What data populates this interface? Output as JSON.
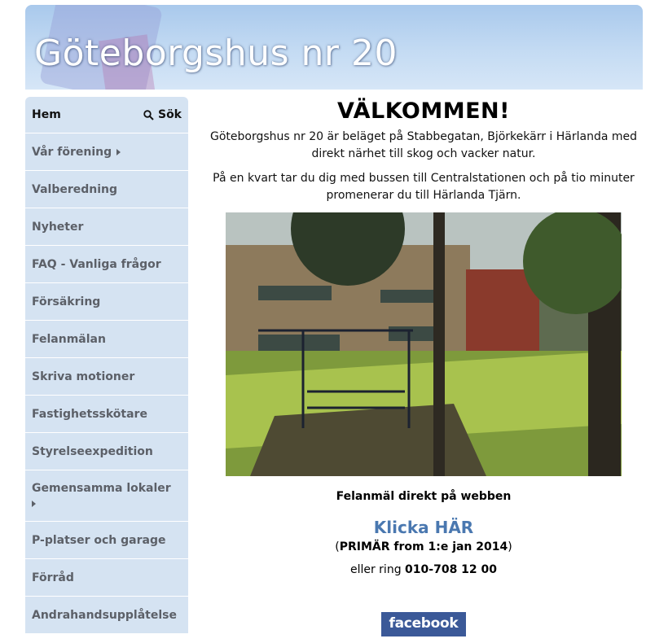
{
  "header": {
    "site_title": "Göteborgshus nr 20"
  },
  "nav": {
    "home_label": "Hem",
    "search_label": "Sök",
    "items": [
      {
        "label": "Vår förening",
        "submenu": true
      },
      {
        "label": "Valberedning",
        "submenu": false
      },
      {
        "label": "Nyheter",
        "submenu": false
      },
      {
        "label": "FAQ - Vanliga frågor",
        "submenu": false
      },
      {
        "label": "Försäkring",
        "submenu": false
      },
      {
        "label": "Felanmälan",
        "submenu": false
      },
      {
        "label": "Skriva motioner",
        "submenu": false
      },
      {
        "label": "Fastighetsskötare",
        "submenu": false
      },
      {
        "label": "Styrelseexpedition",
        "submenu": false
      },
      {
        "label": "Gemensamma lokaler",
        "submenu": true
      },
      {
        "label": "P-platser och garage",
        "submenu": false
      },
      {
        "label": "Förråd",
        "submenu": false
      },
      {
        "label": "Andrahandsupplåtelse",
        "submenu": false
      }
    ]
  },
  "main": {
    "heading": "VÄLKOMMEN!",
    "intro1": "Göteborgshus nr 20 är beläget på Stabbegatan, Björkekärr i Härlanda med direkt närhet till skog och vacker natur.",
    "intro2": "På en kvart tar du dig med bussen till Centralstationen och på tio minuter promenerar du till Härlanda Tjärn.",
    "felan_label": "Felanmäl direkt på webben",
    "klicka_label": "Klicka HÄR",
    "primar_open": "(",
    "primar_text": "PRIMÄR from 1:e jan 2014",
    "primar_close": ")",
    "ring_label": "eller ring ",
    "ring_number": "010-708 12 00",
    "facebook_label": "facebook"
  },
  "colors": {
    "nav_bg": "#d5e3f2",
    "link": "#4a78b0",
    "facebook": "#3b5998"
  }
}
